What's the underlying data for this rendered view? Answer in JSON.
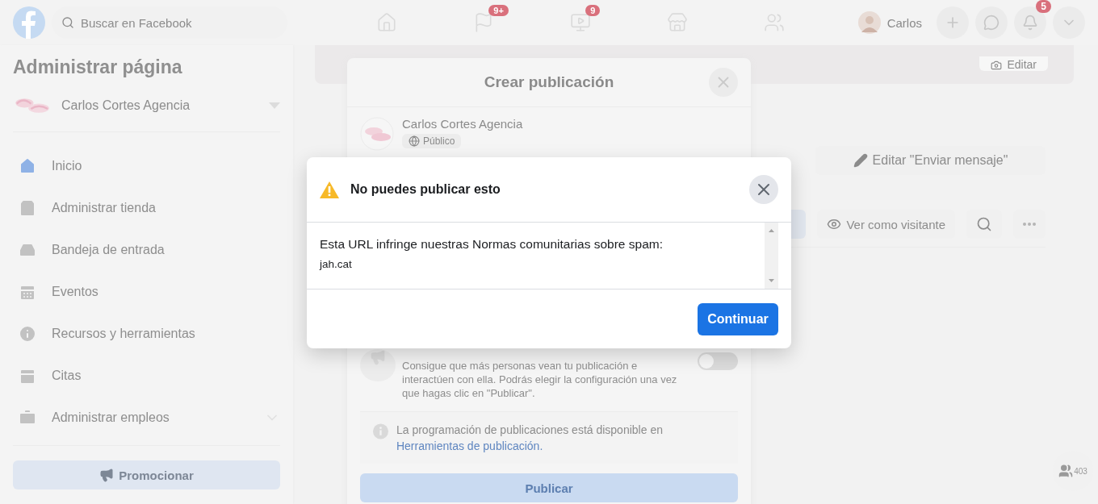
{
  "nav": {
    "search_placeholder": "Buscar en Facebook",
    "tabs": [
      {
        "kind": "home"
      },
      {
        "kind": "flag",
        "badge": "9+"
      },
      {
        "kind": "video",
        "badge": "9"
      },
      {
        "kind": "store"
      },
      {
        "kind": "groups"
      }
    ],
    "profile_name": "Carlos",
    "actions": [
      {
        "kind": "plus"
      },
      {
        "kind": "messenger"
      },
      {
        "kind": "bell",
        "badge": "5"
      },
      {
        "kind": "caret"
      }
    ]
  },
  "sidebar": {
    "title": "Administrar página",
    "page_name": "Carlos Cortes Agencia",
    "items": [
      {
        "kind": "home",
        "label": "Inicio",
        "selected": true,
        "expandable": false
      },
      {
        "kind": "shop",
        "label": "Administrar tienda",
        "selected": false,
        "expandable": false
      },
      {
        "kind": "inbox",
        "label": "Bandeja de entrada",
        "selected": false,
        "expandable": false
      },
      {
        "kind": "events",
        "label": "Eventos",
        "selected": false,
        "expandable": false
      },
      {
        "kind": "info",
        "label": "Recursos y herramientas",
        "selected": false,
        "expandable": false
      },
      {
        "kind": "calendar",
        "label": "Citas",
        "selected": false,
        "expandable": false
      },
      {
        "kind": "jobs",
        "label": "Administrar empleos",
        "selected": false,
        "expandable": true
      }
    ],
    "promote_button": "Promocionar"
  },
  "cover": {
    "edit_button": "Editar"
  },
  "page_actions": {
    "edit_cta": "Editar \"Enviar mensaje\"",
    "view_as": "Ver como visitante"
  },
  "create_post": {
    "title": "Crear publicación",
    "author": "Carlos Cortes Agencia",
    "audience": "Público",
    "boost": {
      "description": "Consigue que más personas vean tu publicación e interactúen con ella. Podrás elegir la configuración una vez que hagas clic en \"Publicar\".",
      "on": false
    },
    "info": {
      "text": "La programación de publicaciones está disponible en",
      "link": "Herramientas de publicación."
    },
    "publish_button": {
      "label": "Publicar",
      "disabled": true
    }
  },
  "alert": {
    "title": "No puedes publicar esto",
    "message": "Esta URL infringe nuestras Normas comunitarias sobre spam:",
    "url": "jah.cat",
    "continue_button": "Continuar"
  },
  "floating": {
    "count": "403"
  }
}
